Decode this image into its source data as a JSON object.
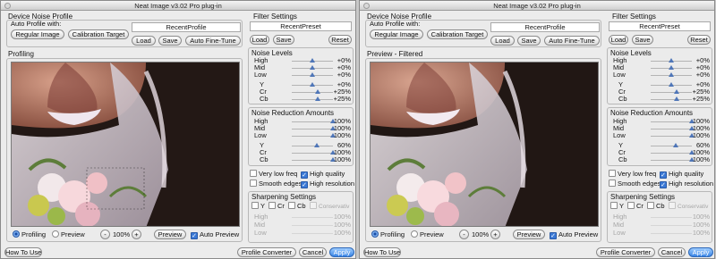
{
  "window_title": "Neat Image v3.02 Pro plug-in",
  "device_noise_profile": {
    "title": "Device Noise Profile",
    "auto_profile_label": "Auto Profile with:",
    "regular_image": "Regular Image",
    "calibration_target": "Calibration Target",
    "profile_name": "RecentProfile",
    "load": "Load",
    "save": "Save",
    "auto_fine_tune": "Auto Fine-Tune"
  },
  "filter_settings": {
    "title": "Filter Settings",
    "preset_name": "RecentPreset",
    "load": "Load",
    "save": "Save",
    "reset": "Reset"
  },
  "noise_levels": {
    "title": "Noise Levels",
    "rows": [
      {
        "label": "High",
        "value": "+0%",
        "level": 0.5
      },
      {
        "label": "Mid",
        "value": "+0%",
        "level": 0.5
      },
      {
        "label": "Low",
        "value": "+0%",
        "level": 0.5
      },
      {
        "label": "Y",
        "value": "+0%",
        "level": 0.5
      },
      {
        "label": "Cr",
        "value": "+25%",
        "level": 0.62
      },
      {
        "label": "Cb",
        "value": "+25%",
        "level": 0.62
      }
    ]
  },
  "noise_reduction": {
    "title": "Noise Reduction Amounts",
    "rows": [
      {
        "label": "High",
        "value": "100%",
        "level": 1.0
      },
      {
        "label": "Mid",
        "value": "100%",
        "level": 1.0
      },
      {
        "label": "Low",
        "value": "100%",
        "level": 1.0
      },
      {
        "label": "Y",
        "value": "60%",
        "level": 0.6
      },
      {
        "label": "Cr",
        "value": "100%",
        "level": 1.0
      },
      {
        "label": "Cb",
        "value": "100%",
        "level": 1.0
      }
    ]
  },
  "options": {
    "very_low_freq": "Very low freq",
    "high_quality": "High quality",
    "smooth_edges": "Smooth edges",
    "high_resolution": "High resolution"
  },
  "sharpening": {
    "title": "Sharpening Settings",
    "channels": [
      "Y",
      "Cr",
      "Cb"
    ],
    "conservative": "Conservativ",
    "rows": [
      {
        "label": "High",
        "value": "100%"
      },
      {
        "label": "Mid",
        "value": "100%"
      },
      {
        "label": "Low",
        "value": "100%"
      }
    ]
  },
  "left_window": {
    "panel_title": "Profiling"
  },
  "right_window": {
    "panel_title": "Preview - Filtered"
  },
  "view_controls": {
    "profiling": "Profiling",
    "preview_radio": "Preview",
    "minus": "-",
    "zoom": "100%",
    "plus": "+",
    "preview_button": "Preview",
    "auto_preview": "Auto Preview"
  },
  "footer": {
    "how_to_use": "How To Use",
    "profile_converter": "Profile Converter",
    "cancel": "Cancel",
    "apply": "Apply"
  },
  "colors": {
    "accent": "#3b79d6",
    "window_bg": "#ececec"
  }
}
